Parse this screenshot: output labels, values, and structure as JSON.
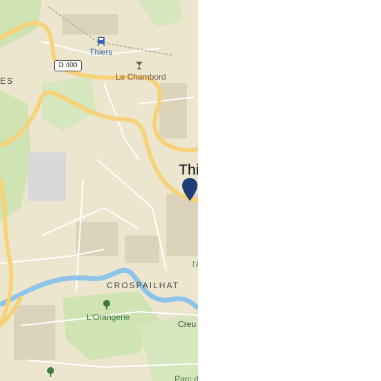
{
  "map": {
    "station_label": "Thiers",
    "poi_label": "Le Chambord",
    "road_label": "D 400",
    "town_label": "Thi",
    "district_label": "CROSPAILHAT",
    "west_label_fragment": "ES",
    "park_label": "L'Orangerie",
    "east_label_fragment_1": "Creu",
    "east_label_fragment_2": "Parc d",
    "east_label_fragment_3": "l'A"
  },
  "icons": {
    "station": "train-station-icon",
    "poi": "bar-icon",
    "pin": "location-pin-icon",
    "park": "tree-icon"
  },
  "colors": {
    "land": "#ede6cf",
    "main_road": "#f6d27a",
    "river": "#8cc4ea",
    "park": "#cfe3b3",
    "pin": "#1f3d77",
    "label_blue": "#2f63b3",
    "label_green": "#3c7a3c"
  }
}
